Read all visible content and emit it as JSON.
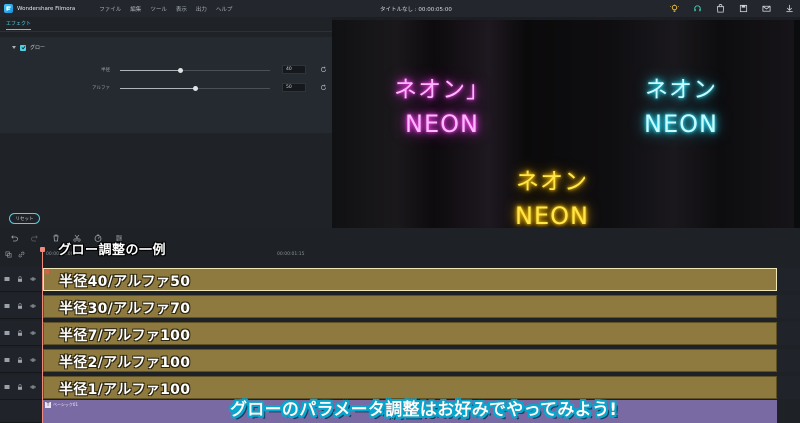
{
  "titlebar": {
    "app_name": "Wondershare Filmora",
    "menu": [
      "ファイル",
      "編集",
      "ツール",
      "表示",
      "出力",
      "ヘルプ"
    ],
    "doc_title": "タイトルなし : 00:00:05:00",
    "icons": [
      "bulb-icon",
      "headset-icon",
      "store-icon",
      "save-icon",
      "mail-icon",
      "download-icon"
    ]
  },
  "effects_panel": {
    "tab_label": "エフェクト",
    "section_label": "グロー",
    "section_checked": true,
    "params": [
      {
        "label": "半径",
        "value": "40",
        "fraction": 0.4
      },
      {
        "label": "アルファ",
        "value": "50",
        "fraction": 0.5
      }
    ],
    "reset_label": "リセット"
  },
  "preview": {
    "groups": [
      {
        "jp": "ネオン」",
        "en": "NEON",
        "color": "pink"
      },
      {
        "jp": "ネオン",
        "en": "NEON",
        "color": "cyan"
      },
      {
        "jp": "ネオン",
        "en": "NEON",
        "color": "yellow"
      }
    ]
  },
  "timeline": {
    "ruler_start": "00:00:00:00",
    "ruler_mark": "00:00:01:15",
    "heading_overlay": "グロー調整の一例",
    "tracks": [
      {
        "label": "半径40/アルファ50",
        "selected": true
      },
      {
        "label": "半径30/アルファ70",
        "selected": false
      },
      {
        "label": "半径7/アルファ100",
        "selected": false
      },
      {
        "label": "半径2/アルファ100",
        "selected": false
      },
      {
        "label": "半径1/アルファ100",
        "selected": false
      }
    ],
    "text_clip_name": "ベーシック01"
  },
  "caption": "グローのパラメータ調整はお好みでやってみよう!"
}
